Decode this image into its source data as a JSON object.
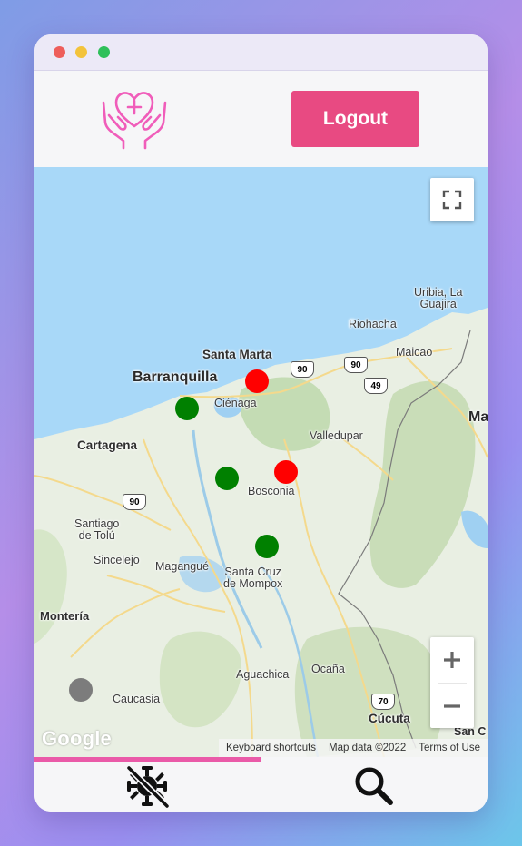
{
  "window": {
    "controls": [
      "close",
      "minimize",
      "maximize"
    ]
  },
  "header": {
    "logo_icon": "hands-heart-icon",
    "logout_label": "Logout",
    "accent_color": "#e84a82"
  },
  "map": {
    "fullscreen_icon": "fullscreen-icon",
    "zoom_in_icon": "plus-icon",
    "zoom_out_icon": "minus-icon",
    "brand": "Google",
    "attribution": {
      "shortcuts": "Keyboard shortcuts",
      "data": "Map data ©2022",
      "terms": "Terms of Use"
    },
    "places": {
      "barranquilla": "Barranquilla",
      "santa_marta": "Santa Marta",
      "cienaga": "Ciénaga",
      "riohacha": "Riohacha",
      "uribia_line1": "Uribia, La",
      "uribia_line2": "Guajira",
      "maicao": "Maicao",
      "cartagena": "Cartagena",
      "valledupar": "Valledupar",
      "bosconia": "Bosconia",
      "santiago_line1": "Santiago",
      "santiago_line2": "de Tolú",
      "sincelejo": "Sincelejo",
      "magangue": "Magangué",
      "mompox_line1": "Santa Cruz",
      "mompox_line2": "de Mompox",
      "monteria": "Montería",
      "aguachica": "Aguachica",
      "ocana": "Ocaña",
      "caucasia": "Caucasia",
      "cucuta": "Cúcuta",
      "san_c": "San C",
      "ma": "Ma"
    },
    "route_shields": {
      "r90a": "90",
      "r90b": "90",
      "r90c": "90",
      "r49": "49",
      "r70": "70"
    },
    "marker_colors": {
      "red": "#ff0000",
      "green": "#008000",
      "gray": "#7c7c7c"
    },
    "markers": [
      {
        "status": "red"
      },
      {
        "status": "green"
      },
      {
        "status": "green"
      },
      {
        "status": "red"
      },
      {
        "status": "green"
      },
      {
        "status": "gray"
      }
    ]
  },
  "progress": {
    "value": 0.5,
    "color": "#ea5aa8"
  },
  "bottom_nav": {
    "items": [
      {
        "icon": "virus-off-icon"
      },
      {
        "icon": "search-icon"
      }
    ]
  }
}
